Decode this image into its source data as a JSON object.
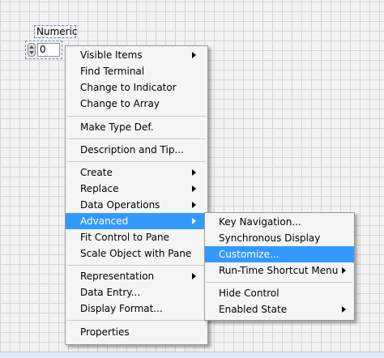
{
  "control": {
    "label": "Numeric",
    "value": "0"
  },
  "context_menu": {
    "items": [
      {
        "label": "Visible Items",
        "submenu": true
      },
      {
        "label": "Find Terminal"
      },
      {
        "label": "Change to Indicator"
      },
      {
        "label": "Change to Array"
      },
      {
        "label": "Make Type Def."
      },
      {
        "label": "Description and Tip..."
      },
      {
        "label": "Create",
        "submenu": true
      },
      {
        "label": "Replace",
        "submenu": true
      },
      {
        "label": "Data Operations",
        "submenu": true
      },
      {
        "label": "Advanced",
        "submenu": true,
        "highlighted": true
      },
      {
        "label": "Fit Control to Pane"
      },
      {
        "label": "Scale Object with Pane"
      },
      {
        "label": "Representation",
        "submenu": true
      },
      {
        "label": "Data Entry..."
      },
      {
        "label": "Display Format..."
      },
      {
        "label": "Properties"
      }
    ]
  },
  "advanced_submenu": {
    "items": [
      {
        "label": "Key Navigation..."
      },
      {
        "label": "Synchronous Display"
      },
      {
        "label": "Customize...",
        "highlighted": true
      },
      {
        "label": "Run-Time Shortcut Menu",
        "submenu": true
      },
      {
        "label": "Hide Control"
      },
      {
        "label": "Enabled State",
        "submenu": true
      }
    ]
  },
  "colors": {
    "highlight": "#3399ff",
    "menu_background": "#f5f5f5",
    "grid_line": "#d4d4d4",
    "canvas": "#f3f3f3"
  }
}
